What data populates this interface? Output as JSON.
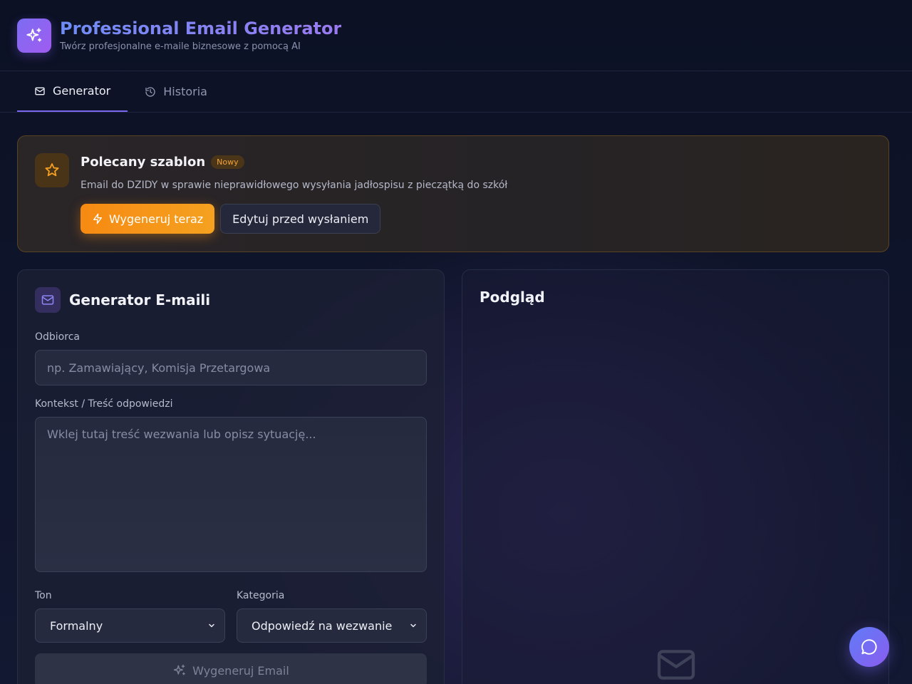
{
  "header": {
    "title": "Professional Email Generator",
    "subtitle": "Twórz profesjonalne e-maile biznesowe z pomocą AI",
    "logo_icon": "sparkles-icon"
  },
  "tabs": [
    {
      "label": "Generator",
      "icon": "mail-icon",
      "active": true
    },
    {
      "label": "Historia",
      "icon": "history-icon",
      "active": false
    }
  ],
  "featured": {
    "title": "Polecany szablon",
    "badge": "Nowy",
    "description": "Email do DZIDY w sprawie nieprawidłowego wysyłania jadłospisu z pieczątką do szkół",
    "primary_button": "Wygeneruj teraz",
    "secondary_button": "Edytuj przed wysłaniem",
    "accent_color": "#f68a12"
  },
  "generator": {
    "title": "Generator E-maili",
    "recipient_label": "Odbiorca",
    "recipient_placeholder": "np. Zamawiający, Komisja Przetargowa",
    "recipient_value": "",
    "context_label": "Kontekst / Treść odpowiedzi",
    "context_placeholder": "Wklej tutaj treść wezwania lub opisz sytuację...",
    "context_value": "",
    "tone_label": "Ton",
    "tone_value": "Formalny",
    "category_label": "Kategoria",
    "category_value": "Odpowiedź na wezwanie",
    "generate_button": "Wygeneruj Email",
    "generate_enabled": false
  },
  "preview": {
    "title": "Podgląd",
    "empty_icon": "mail-icon"
  },
  "chat_fab": {
    "icon": "chat-bubble-icon"
  }
}
